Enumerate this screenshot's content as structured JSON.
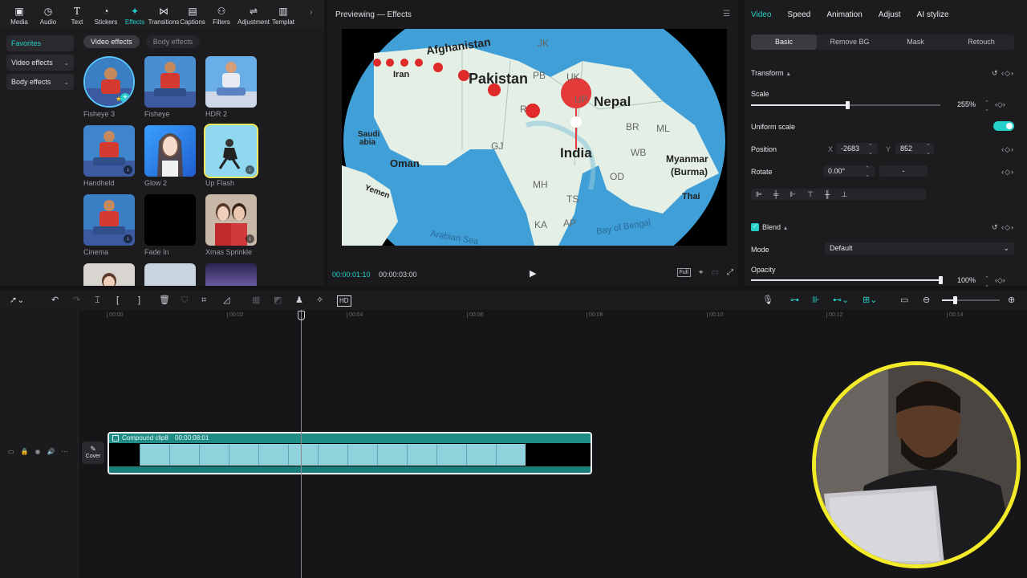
{
  "toolbar": {
    "tools": [
      {
        "label": "Media",
        "icon": "media-icon"
      },
      {
        "label": "Audio",
        "icon": "audio-icon"
      },
      {
        "label": "Text",
        "icon": "text-icon"
      },
      {
        "label": "Stickers",
        "icon": "stickers-icon"
      },
      {
        "label": "Effects",
        "icon": "effects-icon"
      },
      {
        "label": "Transitions",
        "icon": "transitions-icon"
      },
      {
        "label": "Captions",
        "icon": "captions-icon"
      },
      {
        "label": "Filters",
        "icon": "filters-icon"
      },
      {
        "label": "Adjustment",
        "icon": "adjustment-icon"
      },
      {
        "label": "Templat",
        "icon": "templates-icon"
      }
    ],
    "active": "Effects"
  },
  "effects": {
    "side_nav": {
      "favorites": "Favorites",
      "video_effects": "Video effects",
      "body_effects": "Body effects"
    },
    "tabs": {
      "video": "Video effects",
      "body": "Body effects"
    },
    "items": [
      {
        "name": "Fisheye 3"
      },
      {
        "name": "Fisheye"
      },
      {
        "name": "HDR 2"
      },
      {
        "name": "Handheld"
      },
      {
        "name": "Glow 2"
      },
      {
        "name": "Up Flash"
      },
      {
        "name": "Cinema"
      },
      {
        "name": "Fade In"
      },
      {
        "name": "Xmas Sprinkle"
      }
    ]
  },
  "preview": {
    "title": "Previewing — Effects",
    "current_time": "00:00:01:10",
    "total_time": "00:00:03:00",
    "full_label": "Full",
    "map_labels": {
      "afghanistan": "Afghanistan",
      "iran": "Iran",
      "pakistan": "Pakistan",
      "nepal": "Nepal",
      "india": "India",
      "oman": "Oman",
      "myanmar": "Myanmar",
      "burma": "(Burma)",
      "arabian_sea": "Arabian Sea",
      "bay_of_bengal": "Bay of Bengal",
      "thai": "Thai",
      "yemen": "Yemen",
      "saudi": "Saudi",
      "abia": "abia",
      "jk": "JK",
      "pb": "PB",
      "uk": "UK",
      "up": "UP",
      "br": "BR",
      "ml": "ML",
      "gj": "GJ",
      "wb": "WB",
      "od": "OD",
      "mh": "MH",
      "ts": "TS",
      "ka": "KA",
      "ap": "AP",
      "r": "R"
    }
  },
  "inspector": {
    "tabs": [
      "Video",
      "Speed",
      "Animation",
      "Adjust",
      "AI stylize"
    ],
    "sub_tabs": [
      "Basic",
      "Remove BG",
      "Mask",
      "Retouch"
    ],
    "transform_label": "Transform",
    "scale_label": "Scale",
    "scale_value": "255%",
    "scale_fraction": 0.51,
    "uniform_scale_label": "Uniform scale",
    "position_label": "Position",
    "x_label": "X",
    "x_value": "-2683",
    "y_label": "Y",
    "y_value": "852",
    "rotate_label": "Rotate",
    "rotate_value": "0.00°",
    "rotate_dash": "-",
    "blend_label": "Blend",
    "mode_label": "Mode",
    "mode_value": "Default",
    "opacity_label": "Opacity",
    "opacity_value": "100%",
    "opacity_fraction": 1.0
  },
  "timeline": {
    "ruler": [
      "00:00",
      "00:02",
      "00:04",
      "00:06",
      "00:08",
      "00:10",
      "00:12",
      "00:14"
    ],
    "cover_label": "Cover",
    "clip_label": "Compound clip8",
    "clip_duration": "00:00:08:01"
  },
  "colors": {
    "accent": "#25d0c8",
    "webcam_ring": "#f3ea2a"
  }
}
